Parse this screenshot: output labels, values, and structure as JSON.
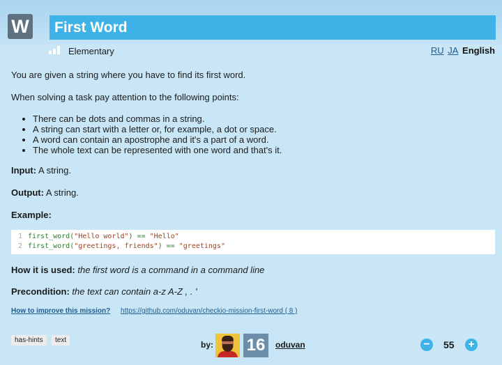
{
  "header": {
    "logo_letter": "W",
    "title": "First Word",
    "difficulty": "Elementary",
    "languages": [
      "RU",
      "JA"
    ],
    "current_language": "English"
  },
  "description": {
    "intro": "You are given a string where you have to find its first word.",
    "points_intro": "When solving a task pay attention to the following points:",
    "points": [
      "There can be dots and commas in a string.",
      "A string can start with a letter or, for example, a dot or space.",
      "A word can contain an apostrophe and it's a part of a word.",
      "The whole text can be represented with one word and that's it."
    ],
    "input_label": "Input:",
    "input_text": "A string.",
    "output_label": "Output:",
    "output_text": "A string.",
    "example_label": "Example:",
    "code_lines": [
      {
        "num": "1",
        "fn": "first_word(",
        "arg": "\"Hello world\"",
        "op": ") == ",
        "res": "\"Hello\""
      },
      {
        "num": "2",
        "fn": "first_word(",
        "arg": "\"greetings, friends\"",
        "op": ") == ",
        "res": "\"greetings\""
      }
    ],
    "usage_label": "How it is used:",
    "usage_text": "the first word is a command in a command line",
    "precondition_label": "Precondition:",
    "precondition_text": "the text can contain a-z A-Z , . '"
  },
  "links": {
    "improve": "How to improve this mission?",
    "github": "https://github.com/oduvan/checkio-mission-first-word",
    "github_count": "( 8 )"
  },
  "tags": [
    "has-hints",
    "text"
  ],
  "author": {
    "by_label": "by:",
    "level": "16",
    "name": "oduvan"
  },
  "votes": {
    "minus": "−",
    "score": "55",
    "plus": "+"
  },
  "colors": {
    "background": "#c8e6f6",
    "title_bar": "#3fb3e8",
    "logo": "#5d7180",
    "level_badge": "#6d8eaa",
    "link": "#1f5c8e"
  }
}
